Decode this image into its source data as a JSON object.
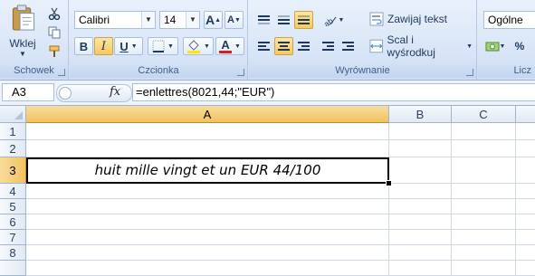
{
  "ribbon": {
    "clipboard": {
      "paste_label": "Wklej",
      "group_label": "Schowek"
    },
    "font": {
      "name": "Calibri",
      "size": "14",
      "grow_label": "A",
      "shrink_label": "A",
      "bold_label": "B",
      "italic_label": "I",
      "underline_label": "U",
      "font_color_label": "A",
      "group_label": "Czcionka"
    },
    "alignment": {
      "wrap_text_label": "Zawijaj tekst",
      "merge_center_label": "Scal i wyśrodkuj",
      "group_label": "Wyrównanie"
    },
    "number": {
      "format": "Ogólne",
      "percent_label": "%",
      "group_label": "Licz"
    }
  },
  "formula_bar": {
    "name_box": "A3",
    "fx_label": "fx",
    "formula": "=enlettres(8021,44;\"EUR\")"
  },
  "sheet": {
    "columns": [
      "A",
      "B",
      "C"
    ],
    "rows": [
      "1",
      "2",
      "3",
      "4",
      "5",
      "6",
      "7",
      "8"
    ],
    "active_cell_value": "huit mille vingt et un EUR 44/100"
  },
  "colors": {
    "accent": "#f8c85a",
    "ribbon_bg": "#dbe7f8",
    "font_color_underline": "#d42020",
    "highlight_underline": "#ffe600"
  }
}
